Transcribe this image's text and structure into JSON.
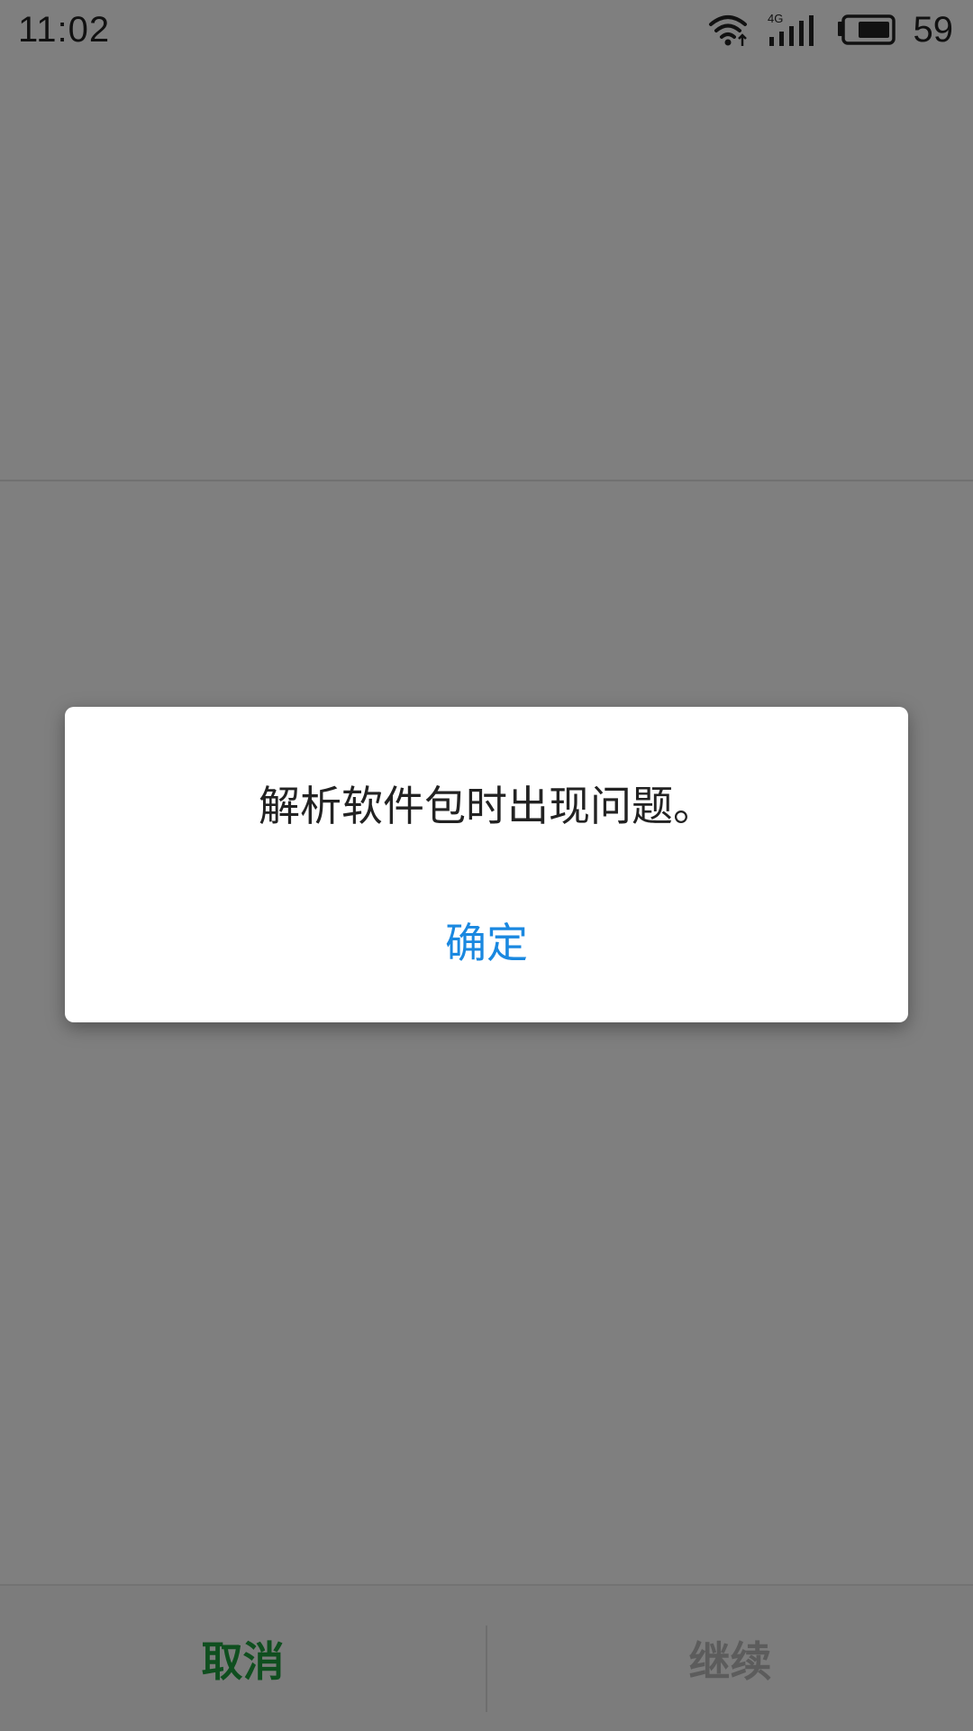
{
  "status_bar": {
    "time": "11:02",
    "network_type": "4G",
    "battery_level": "59",
    "icons": [
      "wifi-icon",
      "cell-signal-icon",
      "battery-icon"
    ]
  },
  "bottom_bar": {
    "cancel_label": "取消",
    "continue_label": "继续"
  },
  "dialog": {
    "message": "解析软件包时出现问题。",
    "ok_label": "确定"
  },
  "colors": {
    "scrim": "#000000",
    "ok_accent": "#1a88e0",
    "cancel_accent": "#1e9e3e",
    "continue_disabled": "#b9b9b9"
  }
}
